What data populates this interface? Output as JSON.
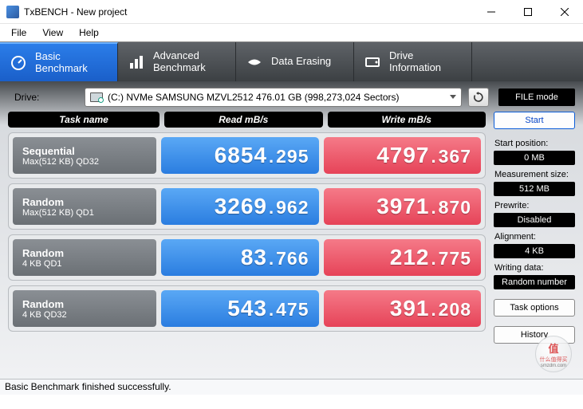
{
  "window": {
    "title": "TxBENCH - New project"
  },
  "menu": {
    "file": "File",
    "view": "View",
    "help": "Help"
  },
  "tabs": {
    "basic": "Basic\nBenchmark",
    "advanced": "Advanced\nBenchmark",
    "erasing": "Data Erasing",
    "drive": "Drive\nInformation"
  },
  "drive": {
    "label": "Drive:",
    "selected": "(C:) NVMe SAMSUNG MZVL2512  476.01 GB  (998,273,024 Sectors)",
    "file_mode": "FILE mode"
  },
  "headers": {
    "task": "Task name",
    "read": "Read mB/s",
    "write": "Write mB/s"
  },
  "rows": [
    {
      "title": "Sequential",
      "sub": "Max(512 KB) QD32",
      "read_int": "6854",
      "read_frac": "295",
      "write_int": "4797",
      "write_frac": "367"
    },
    {
      "title": "Random",
      "sub": "Max(512 KB) QD1",
      "read_int": "3269",
      "read_frac": "962",
      "write_int": "3971",
      "write_frac": "870"
    },
    {
      "title": "Random",
      "sub": "4 KB QD1",
      "read_int": "83",
      "read_frac": "766",
      "write_int": "212",
      "write_frac": "775"
    },
    {
      "title": "Random",
      "sub": "4 KB QD32",
      "read_int": "543",
      "read_frac": "475",
      "write_int": "391",
      "write_frac": "208"
    }
  ],
  "side": {
    "start": "Start",
    "start_pos_label": "Start position:",
    "start_pos": "0 MB",
    "meas_label": "Measurement size:",
    "meas": "512 MB",
    "prewrite_label": "Prewrite:",
    "prewrite": "Disabled",
    "align_label": "Alignment:",
    "align": "4 KB",
    "wdata_label": "Writing data:",
    "wdata": "Random number",
    "task_options": "Task options",
    "history": "History"
  },
  "status": "Basic Benchmark finished successfully.",
  "watermark": {
    "big": "值",
    "mid": "什么值得买",
    "small": "smzdm.com"
  }
}
